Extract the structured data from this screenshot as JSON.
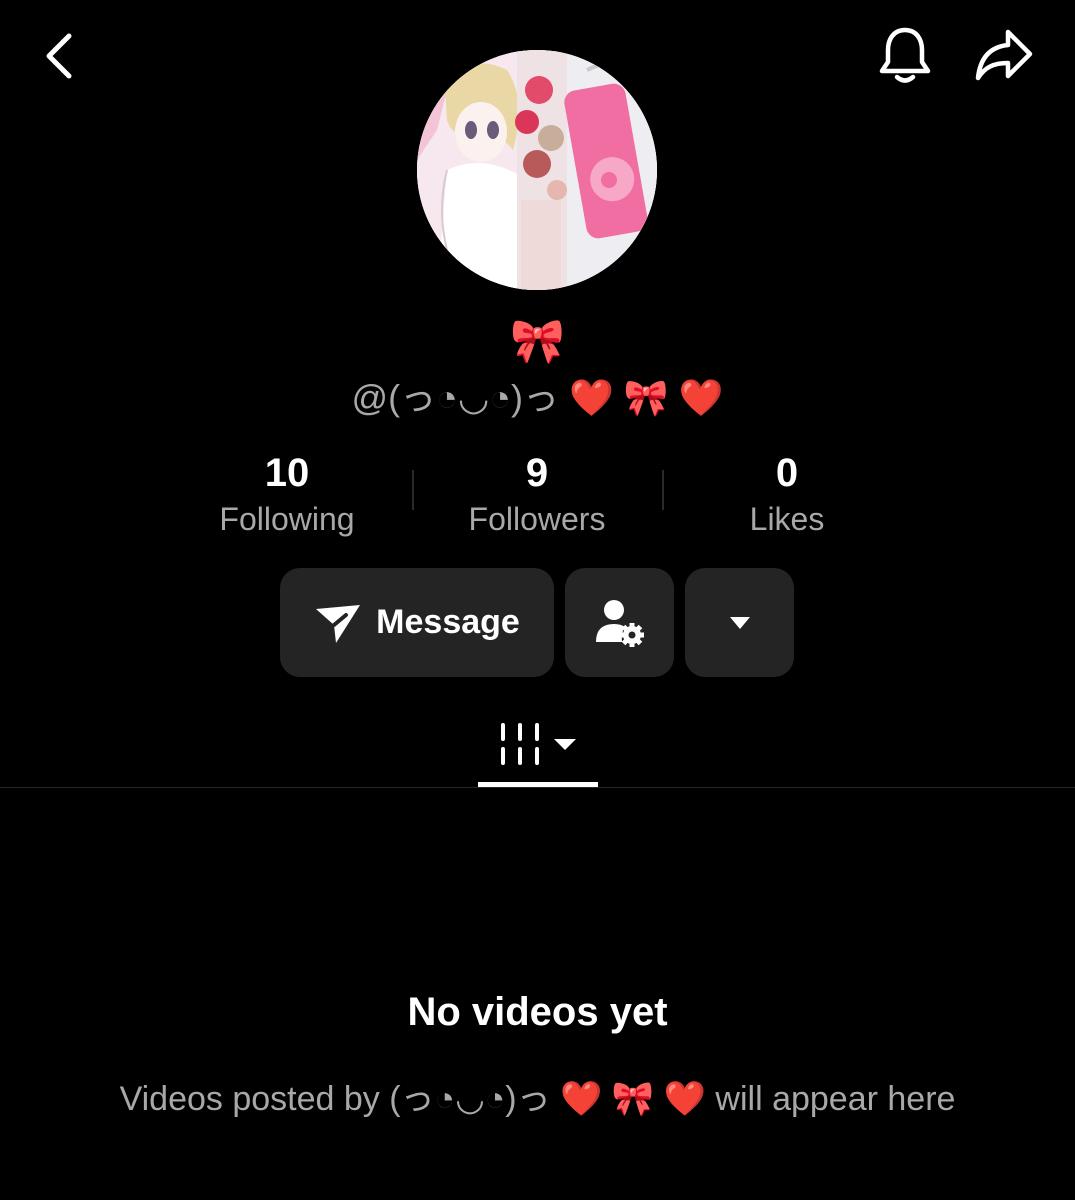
{
  "nav": {
    "back_icon": "chevron-left-icon",
    "notification_icon": "bell-icon",
    "share_icon": "share-arrow-icon"
  },
  "profile": {
    "nickname": "🎀",
    "username": "@(っ◔◡◔)っ ❤️ 🎀 ❤️"
  },
  "stats": {
    "following_count": "10",
    "following_label": "Following",
    "followers_count": "9",
    "followers_label": "Followers",
    "likes_count": "0",
    "likes_label": "Likes"
  },
  "actions": {
    "message_label": "Message",
    "message_icon": "send-icon",
    "friend_settings_icon": "user-gear-icon",
    "more_icon": "caret-down-icon"
  },
  "tabs": {
    "videos_icon": "grid-lines-icon",
    "dropdown_icon": "caret-down-icon"
  },
  "empty_state": {
    "title": "No videos yet",
    "subtitle": "Videos posted by (っ◔◡◔)っ ❤️ 🎀 ❤️ will appear here"
  },
  "colors": {
    "background": "#000000",
    "button_bg": "#242424",
    "secondary_text": "#a8a8a8",
    "heart": "#d0161e",
    "ribbon": "#f08cb4"
  }
}
